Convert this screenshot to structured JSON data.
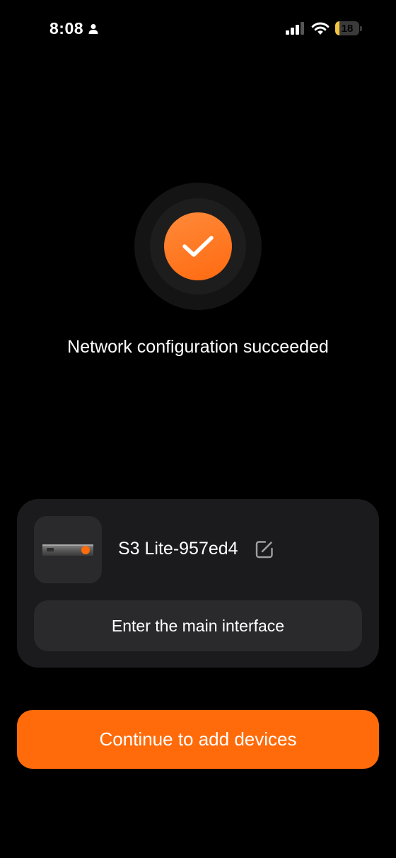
{
  "status_bar": {
    "time": "8:08",
    "battery_level": "18",
    "battery_fraction": 0.18,
    "icons": [
      "person-icon",
      "signal-icon",
      "wifi-icon",
      "battery-icon"
    ]
  },
  "success": {
    "icon": "checkmark-icon",
    "title": "Network configuration succeeded",
    "accent_color": "#ff6b0a"
  },
  "device_card": {
    "device_name": "S3 Lite-957ed4",
    "edit_icon": "edit-icon",
    "enter_label": "Enter the main interface"
  },
  "actions": {
    "continue_label": "Continue to add devices"
  }
}
